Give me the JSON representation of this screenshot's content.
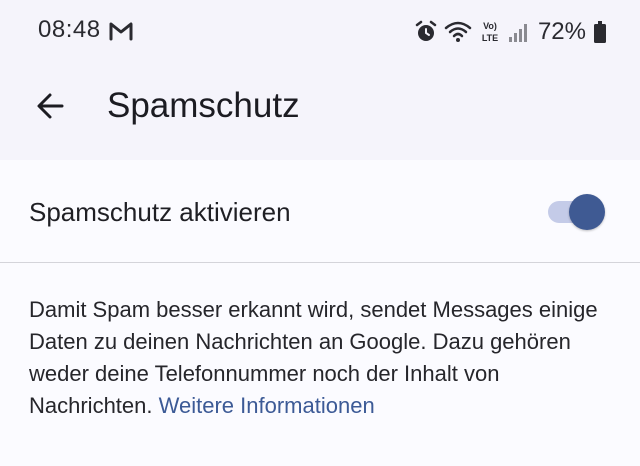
{
  "status_bar": {
    "time": "08:48",
    "battery_percent": "72%",
    "network_label": "Vo) LTE",
    "icons": [
      "gmail-icon",
      "alarm-icon",
      "wifi-icon",
      "volte-icon",
      "signal-icon",
      "battery-icon"
    ]
  },
  "app_bar": {
    "title": "Spamschutz",
    "back_icon": "arrow-back-icon"
  },
  "setting": {
    "label": "Spamschutz aktivieren",
    "enabled": true
  },
  "description": {
    "text": "Damit Spam besser erkannt wird, sendet Messages einige Daten zu deinen Nachrichten an Google. Dazu gehören weder deine Telefonnummer noch der Inhalt von Nachrichten.",
    "link_text": "Weitere Informationen"
  },
  "colors": {
    "accent": "#3f5a93",
    "toggle_track": "#c4cbe8",
    "link": "#3c5a96",
    "header_bg": "#f5f4fb",
    "page_bg": "#fbfbff"
  }
}
